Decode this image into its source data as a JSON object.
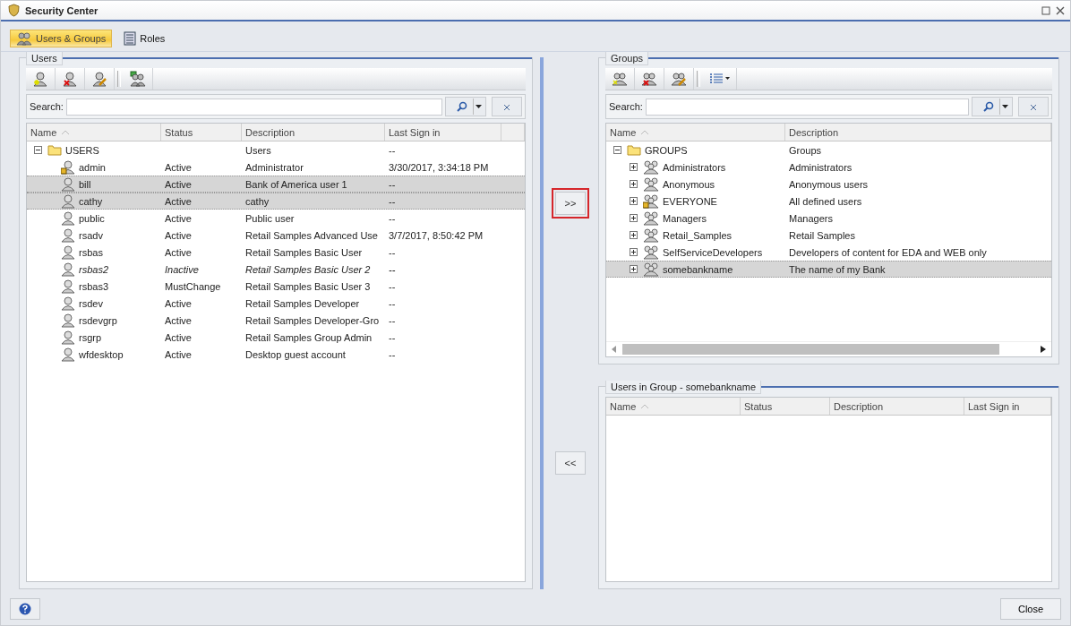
{
  "window": {
    "title": "Security Center"
  },
  "tabs": [
    {
      "label": "Users & Groups",
      "selected": true
    },
    {
      "label": "Roles",
      "selected": false
    }
  ],
  "users_panel": {
    "title": "Users",
    "search_label": "Search:",
    "columns": [
      "Name",
      "Status",
      "Description",
      "Last Sign in"
    ],
    "tree": [
      {
        "kind": "folder",
        "name": "USERS",
        "description": "Users",
        "last_sign_in": "--",
        "expanded": true,
        "children": [
          {
            "kind": "user",
            "name": "admin",
            "status": "Active",
            "description": "Administrator",
            "last_sign_in": "3/30/2017, 3:34:18 PM",
            "selected": false,
            "disabled": false,
            "locked": true
          },
          {
            "kind": "user",
            "name": "bill",
            "status": "Active",
            "description": "Bank of America user 1",
            "last_sign_in": "--",
            "selected": true,
            "disabled": false,
            "locked": false
          },
          {
            "kind": "user",
            "name": "cathy",
            "status": "Active",
            "description": "cathy",
            "last_sign_in": "--",
            "selected": true,
            "disabled": false,
            "locked": false
          },
          {
            "kind": "user",
            "name": "public",
            "status": "Active",
            "description": "Public user",
            "last_sign_in": "--",
            "selected": false,
            "disabled": false,
            "locked": false
          },
          {
            "kind": "user",
            "name": "rsadv",
            "status": "Active",
            "description": "Retail Samples Advanced Use",
            "last_sign_in": "3/7/2017, 8:50:42 PM",
            "selected": false,
            "disabled": false,
            "locked": false
          },
          {
            "kind": "user",
            "name": "rsbas",
            "status": "Active",
            "description": "Retail Samples Basic User",
            "last_sign_in": "--",
            "selected": false,
            "disabled": false,
            "locked": false
          },
          {
            "kind": "user",
            "name": "rsbas2",
            "status": "Inactive",
            "description": "Retail Samples Basic User 2",
            "last_sign_in": "--",
            "selected": false,
            "disabled": true,
            "locked": false
          },
          {
            "kind": "user",
            "name": "rsbas3",
            "status": "MustChange",
            "description": "Retail Samples Basic User 3",
            "last_sign_in": "--",
            "selected": false,
            "disabled": false,
            "locked": false
          },
          {
            "kind": "user",
            "name": "rsdev",
            "status": "Active",
            "description": "Retail Samples Developer",
            "last_sign_in": "--",
            "selected": false,
            "disabled": false,
            "locked": false
          },
          {
            "kind": "user",
            "name": "rsdevgrp",
            "status": "Active",
            "description": "Retail Samples Developer-Gro",
            "last_sign_in": "--",
            "selected": false,
            "disabled": false,
            "locked": false
          },
          {
            "kind": "user",
            "name": "rsgrp",
            "status": "Active",
            "description": "Retail Samples Group Admin",
            "last_sign_in": "--",
            "selected": false,
            "disabled": false,
            "locked": false
          },
          {
            "kind": "user",
            "name": "wfdesktop",
            "status": "Active",
            "description": "Desktop guest account",
            "last_sign_in": "--",
            "selected": false,
            "disabled": false,
            "locked": false
          }
        ]
      }
    ]
  },
  "transfer_buttons": [
    {
      "label": ">>",
      "highlighted": true
    },
    {
      "label": "<<",
      "highlighted": false
    }
  ],
  "groups_panel": {
    "title": "Groups",
    "search_label": "Search:",
    "columns": [
      "Name",
      "Description"
    ],
    "tree": [
      {
        "kind": "folder",
        "name": "GROUPS",
        "description": "Groups",
        "expanded": true,
        "children": [
          {
            "kind": "group",
            "name": "Administrators",
            "description": "Administrators",
            "expanded": false,
            "selected": false,
            "locked": false
          },
          {
            "kind": "group",
            "name": "Anonymous",
            "description": "Anonymous users",
            "expanded": false,
            "selected": false,
            "locked": false
          },
          {
            "kind": "group",
            "name": "EVERYONE",
            "description": "All defined users",
            "expanded": false,
            "selected": false,
            "locked": true
          },
          {
            "kind": "group",
            "name": "Managers",
            "description": "Managers",
            "expanded": false,
            "selected": false,
            "locked": false
          },
          {
            "kind": "group",
            "name": "Retail_Samples",
            "description": "Retail Samples",
            "expanded": false,
            "selected": false,
            "locked": false
          },
          {
            "kind": "group",
            "name": "SelfServiceDevelopers",
            "description": "Developers of content for EDA and WEB only",
            "expanded": false,
            "selected": false,
            "locked": false
          },
          {
            "kind": "group",
            "name": "somebankname",
            "description": "The name of my Bank",
            "expanded": false,
            "selected": true,
            "locked": false
          }
        ]
      }
    ]
  },
  "members_panel": {
    "title": "Users in Group - somebankname",
    "columns": [
      "Name",
      "Status",
      "Description",
      "Last Sign in"
    ]
  },
  "footer": {
    "close_label": "Close"
  }
}
